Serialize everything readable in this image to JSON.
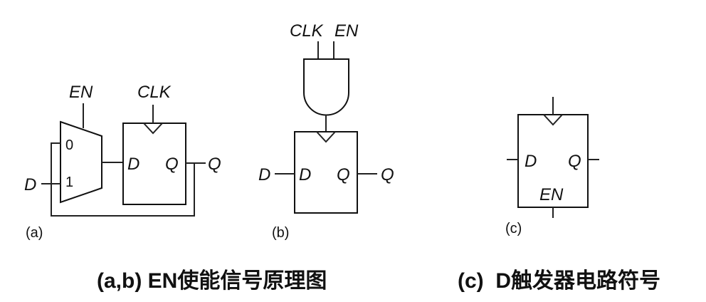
{
  "diagram_a": {
    "en": "EN",
    "clk": "CLK",
    "mux_in0": "0",
    "mux_in1": "1",
    "d_input": "D",
    "ff_d": "D",
    "ff_q": "Q",
    "q_output": "Q",
    "tag": "(a)"
  },
  "diagram_b": {
    "clk": "CLK",
    "en": "EN",
    "d_input": "D",
    "ff_d": "D",
    "ff_q": "Q",
    "q_output": "Q",
    "tag": "(b)"
  },
  "diagram_c": {
    "ff_d": "D",
    "ff_q": "Q",
    "ff_en": "EN",
    "tag": "(c)"
  },
  "captions": {
    "left": "(a,b) EN使能信号原理图",
    "right": "(c)  D触发器电路符号"
  }
}
